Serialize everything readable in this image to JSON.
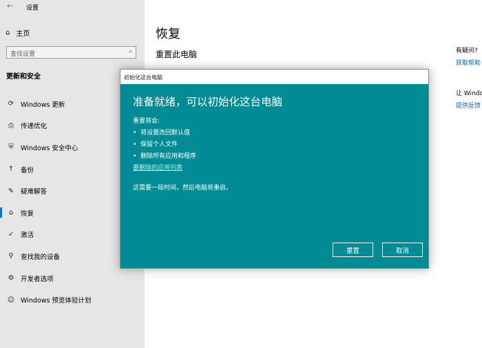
{
  "app": {
    "title": "设置",
    "back": "←"
  },
  "sidebar": {
    "home": "主页",
    "search_placeholder": "查找设置",
    "section": "更新和安全",
    "items": [
      {
        "label": "Windows 更新",
        "icon": "⟳"
      },
      {
        "label": "传递优化",
        "icon": "⎙"
      },
      {
        "label": "Windows 安全中心",
        "icon": "⛨"
      },
      {
        "label": "备份",
        "icon": "↑"
      },
      {
        "label": "疑难解答",
        "icon": "✎"
      },
      {
        "label": "恢复",
        "icon": "⌂"
      },
      {
        "label": "激活",
        "icon": "✓"
      },
      {
        "label": "查找我的设备",
        "icon": "⚲"
      },
      {
        "label": "开发者选项",
        "icon": "⚙"
      },
      {
        "label": "Windows 预览体验计划",
        "icon": "☺"
      }
    ]
  },
  "main": {
    "title": "恢复",
    "subtitle": "重置此电脑"
  },
  "right": {
    "q": "有疑问?",
    "help": "获取帮助",
    "let": "让 Windows",
    "feedback": "提供反馈"
  },
  "dialog": {
    "title": "初始化这台电脑",
    "heading": "准备就绪，可以初始化这台电脑",
    "intro": "重置将会:",
    "bullets": [
      "将设置改回默认值",
      "保留个人文件",
      "删除所有应用和程序"
    ],
    "link": "要删除的应用列表",
    "note": "这需要一段时间，然后电脑将重启。",
    "reset": "重置",
    "cancel": "取消"
  }
}
